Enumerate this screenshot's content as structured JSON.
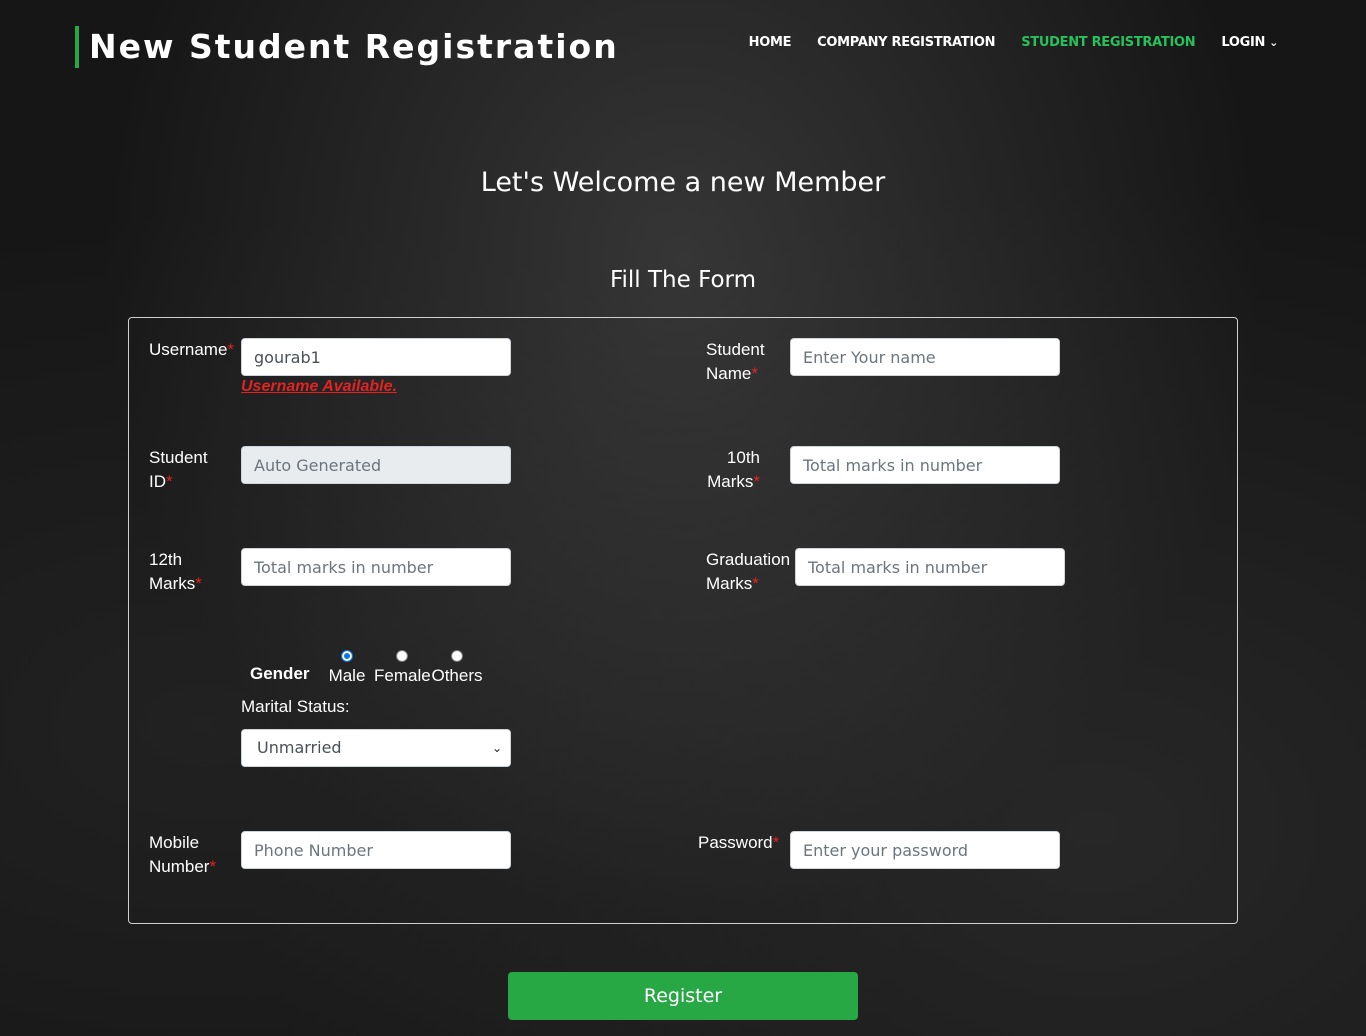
{
  "header": {
    "brand_title": "New Student Registration",
    "nav": {
      "home": "HOME",
      "company_registration": "COMPANY REGISTRATION",
      "student_registration": "STUDENT REGISTRATION",
      "login": "LOGIN"
    },
    "active_nav": "STUDENT REGISTRATION",
    "accent_color": "#28c15b"
  },
  "main": {
    "welcome": "Let's Welcome a new Member",
    "fill_title": "Fill The Form"
  },
  "form": {
    "required_mark": "*",
    "username": {
      "label": "Username",
      "value": "gourab1",
      "status": "Username Available."
    },
    "student_name": {
      "label_line1": "Student",
      "label_line2": "Name",
      "placeholder": "Enter Your name"
    },
    "student_id": {
      "label_line1": "Student",
      "label_line2": "ID",
      "placeholder": "Auto Generated"
    },
    "tenth_marks": {
      "label_line1": "10th",
      "label_line2": "Marks",
      "placeholder": "Total marks in number"
    },
    "twelfth_marks": {
      "label_line1": "12th",
      "label_line2": "Marks",
      "placeholder": "Total marks in number"
    },
    "graduation_marks": {
      "label_line1": "Graduation",
      "label_line2": "Marks",
      "placeholder": "Total marks in number"
    },
    "gender": {
      "label": "Gender",
      "options": [
        "Male",
        "Female",
        "Others"
      ],
      "selected": "Male"
    },
    "marital_status": {
      "label": "Marital Status:",
      "selected": "Unmarried"
    },
    "mobile": {
      "label_line1": "Mobile",
      "label_line2": "Number",
      "placeholder": "Phone Number"
    },
    "password": {
      "label": "Password",
      "placeholder": "Enter your password"
    },
    "register_button": "Register"
  },
  "colors": {
    "primary_green": "#28a745",
    "required_red": "#e32222",
    "radio_blue": "#0b74e5"
  }
}
